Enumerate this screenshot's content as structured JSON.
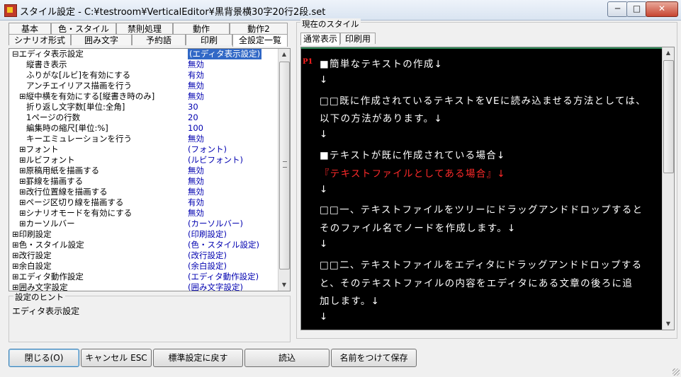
{
  "window": {
    "title": "スタイル設定 - C:¥testroom¥VerticalEditor¥黒背景横30字20行2段.set",
    "min_glyph": "─",
    "max_glyph": "□",
    "close_glyph": "✕"
  },
  "left_tabs_row1": [
    "基本",
    "色・スタイル",
    "禁則処理",
    "動作",
    "動作2"
  ],
  "left_tabs_row2": [
    "シナリオ形式",
    "囲み文字",
    "予約語",
    "印刷",
    "全設定一覧"
  ],
  "properties": [
    {
      "name": "⊟エディタ表示設定",
      "value": "(エディタ表示設定)"
    },
    {
      "name": "縦書き表示",
      "value": "無効"
    },
    {
      "name": "ふりがな[ルビ]を有効にする",
      "value": "有効"
    },
    {
      "name": "アンチエイリアス描画を行う",
      "value": "無効"
    },
    {
      "name": "⊞縦中横を有効にする[縦書き時のみ]",
      "value": "無効"
    },
    {
      "name": "折り返し文字数[単位:全角]",
      "value": "30"
    },
    {
      "name": "1ページの行数",
      "value": "20"
    },
    {
      "name": "編集時の縮尺[単位:%]",
      "value": "100"
    },
    {
      "name": "キーエミュレーションを行う",
      "value": "無効"
    },
    {
      "name": "⊞フォント",
      "value": "(フォント)"
    },
    {
      "name": "⊞ルビフォント",
      "value": "(ルビフォント)"
    },
    {
      "name": "⊞原稿用紙を描画する",
      "value": "無効"
    },
    {
      "name": "⊞罫線を描画する",
      "value": "無効"
    },
    {
      "name": "⊞改行位置線を描画する",
      "value": "無効"
    },
    {
      "name": "⊞ページ区切り線を描画する",
      "value": "有効"
    },
    {
      "name": "⊞シナリオモードを有効にする",
      "value": "無効"
    },
    {
      "name": "⊞カーソルバー",
      "value": "(カーソルバー)"
    },
    {
      "name": "⊞印刷設定",
      "value": "(印刷設定)"
    },
    {
      "name": "⊞色・スタイル設定",
      "value": "(色・スタイル設定)"
    },
    {
      "name": "⊞改行設定",
      "value": "(改行設定)"
    },
    {
      "name": "⊞余白設定",
      "value": "(余白設定)"
    },
    {
      "name": "⊞エディタ動作設定",
      "value": "(エディタ動作設定)"
    },
    {
      "name": "⊞囲み文字設定",
      "value": "(囲み文字設定)"
    }
  ],
  "hint": {
    "label": "設定のヒント",
    "text": "エディタ表示設定"
  },
  "current_style": {
    "label": "現在のスタイル",
    "tabs": [
      "通常表示",
      "印刷用"
    ]
  },
  "preview": {
    "page_marker": "P1",
    "lines": [
      {
        "text": "■簡単なテキストの作成↓",
        "red": false
      },
      {
        "text": "↓",
        "red": false
      },
      {
        "text": "□□既に作成されているテキストをVEに読み込ませる方法としては、",
        "red": false
      },
      {
        "text": "以下の方法があります。↓",
        "red": false
      },
      {
        "text": "↓",
        "red": false
      },
      {
        "text": "■テキストが既に作成されている場合↓",
        "red": false
      },
      {
        "text": "『テキストファイルとしてある場合』↓",
        "red": true
      },
      {
        "text": "↓",
        "red": false
      },
      {
        "text": "□□一、テキストファイルをツリーにドラッグアンドドロップすると",
        "red": false
      },
      {
        "text": "そのファイル名でノードを作成します。↓",
        "red": false
      },
      {
        "text": "↓",
        "red": false
      },
      {
        "text": "□□二、テキストファイルをエディタにドラッグアンドドロップする",
        "red": false
      },
      {
        "text": "と、そのテキストファイルの内容をエディタにある文章の後ろに追",
        "red": false
      },
      {
        "text": "加します。↓",
        "red": false
      },
      {
        "text": "↓",
        "red": false
      }
    ]
  },
  "buttons": {
    "close": "閉じる(O)",
    "cancel": "キャンセル ESC",
    "reset": "標準設定に戻す",
    "load": "読込",
    "save_as": "名前をつけて保存"
  },
  "colors": {
    "selection": "#3168c6",
    "value_text": "#0000b0",
    "preview_bg": "#000000",
    "preview_red": "#ff2a2a"
  }
}
